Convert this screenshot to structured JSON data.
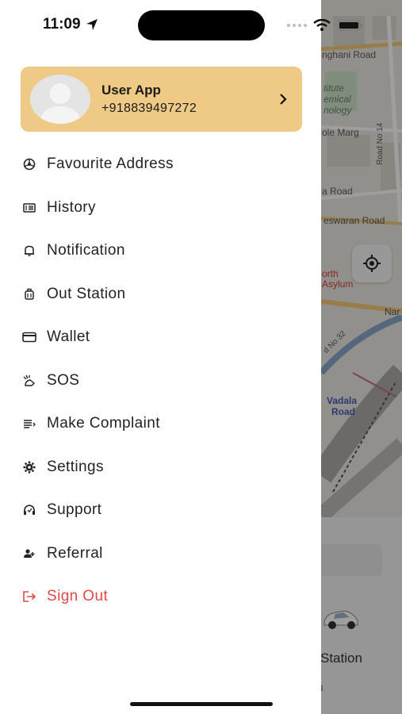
{
  "status_bar": {
    "time": "11:09"
  },
  "profile": {
    "name": "User App",
    "phone": "+918839497272"
  },
  "menu": {
    "items": [
      {
        "label": "Favourite Address",
        "icon": "favourite-address-icon"
      },
      {
        "label": "History",
        "icon": "history-icon"
      },
      {
        "label": "Notification",
        "icon": "bell-icon"
      },
      {
        "label": "Out Station",
        "icon": "luggage-icon"
      },
      {
        "label": "Wallet",
        "icon": "wallet-icon"
      },
      {
        "label": "SOS",
        "icon": "sos-icon"
      },
      {
        "label": "Make Complaint",
        "icon": "complaint-icon"
      },
      {
        "label": "Settings",
        "icon": "gear-icon"
      },
      {
        "label": "Support",
        "icon": "support-icon"
      },
      {
        "label": "Referral",
        "icon": "referral-icon"
      },
      {
        "label": "Sign Out",
        "icon": "sign-out-icon"
      }
    ]
  },
  "map": {
    "labels": [
      "nghani Road",
      "titute",
      "emical",
      "nology",
      "ole Marg",
      "a Road",
      "Road No 14",
      "eswaran Road",
      "orth",
      "Asylum",
      "Nar",
      "d No 32",
      "Vadala",
      "Road"
    ],
    "sheet_label": "Station"
  },
  "colors": {
    "accent": "#efca86",
    "signout": "#e34848"
  }
}
